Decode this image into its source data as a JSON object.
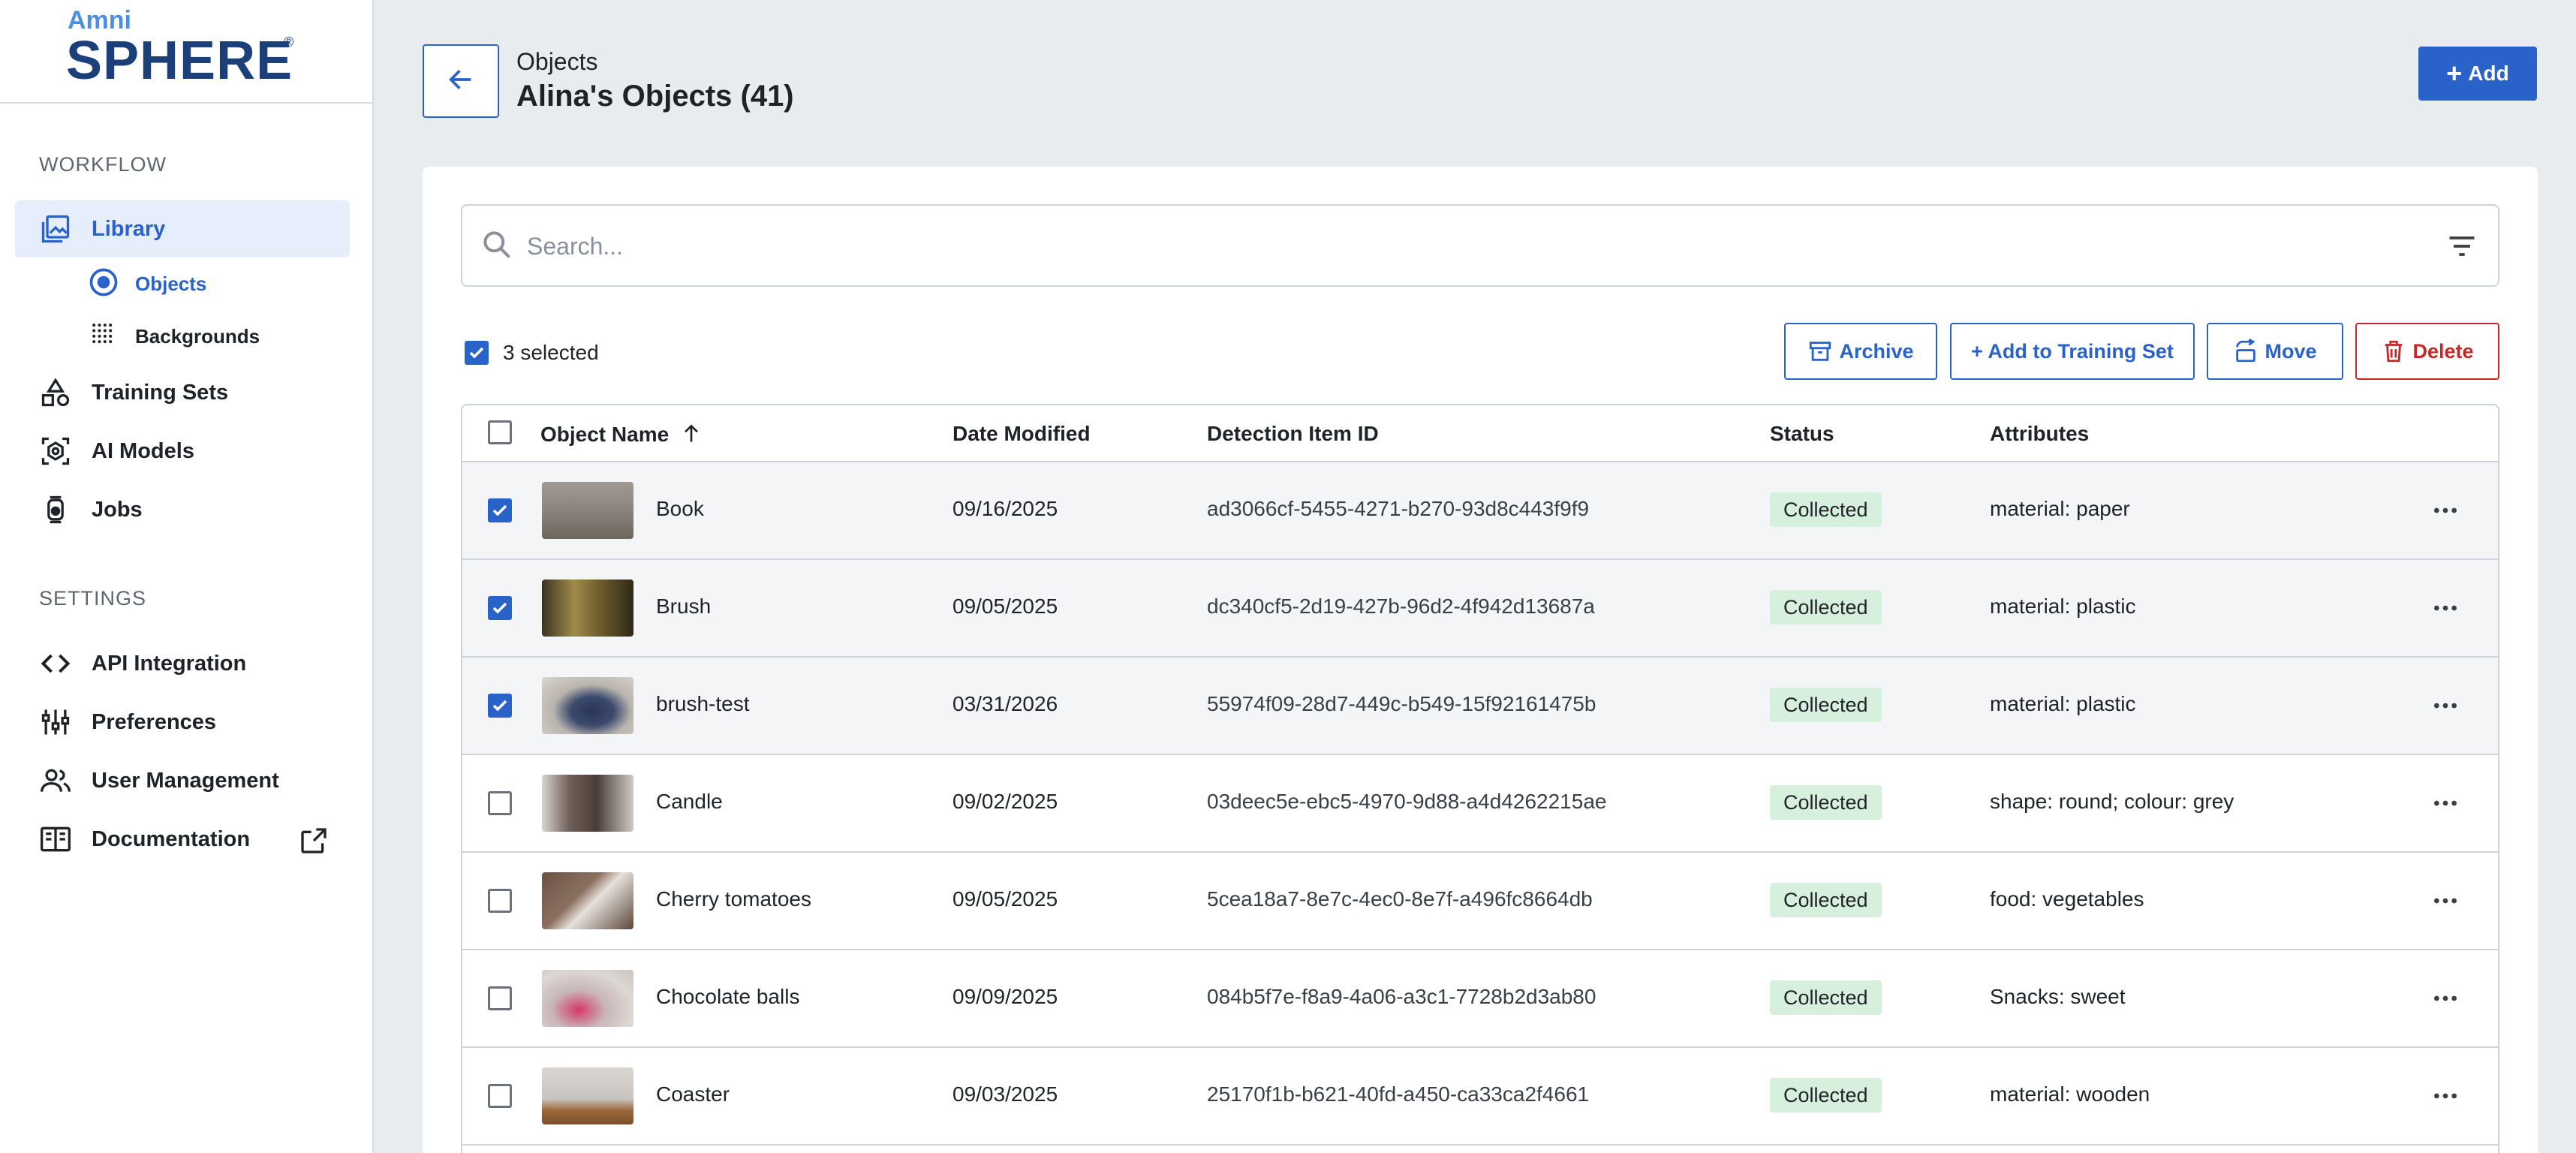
{
  "logo": {
    "small": "Amni",
    "big": "SPHERE",
    "reg": "®"
  },
  "sidebar": {
    "workflow_label": "WORKFLOW",
    "settings_label": "SETTINGS",
    "library": "Library",
    "objects": "Objects",
    "backgrounds": "Backgrounds",
    "training_sets": "Training Sets",
    "ai_models": "AI Models",
    "jobs": "Jobs",
    "api_integration": "API Integration",
    "preferences": "Preferences",
    "user_management": "User Management",
    "documentation": "Documentation"
  },
  "header": {
    "breadcrumb": "Objects",
    "title": "Alina's Objects (41)",
    "add_label": "Add",
    "add_plus": "+"
  },
  "search": {
    "placeholder": "Search..."
  },
  "selection": {
    "text": "3 selected"
  },
  "actions": {
    "archive": "Archive",
    "add_training": "+ Add to Training Set",
    "move": "Move",
    "delete": "Delete"
  },
  "table": {
    "headers": {
      "name": "Object Name",
      "date": "Date Modified",
      "detection_id": "Detection Item ID",
      "status": "Status",
      "attributes": "Attributes"
    },
    "rows": [
      {
        "name": "Book",
        "date": "09/16/2025",
        "id": "ad3066cf-5455-4271-b270-93d8c443f9f9",
        "status": "Collected",
        "attributes": "material: paper",
        "selected": true
      },
      {
        "name": "Brush",
        "date": "09/05/2025",
        "id": "dc340cf5-2d19-427b-96d2-4f942d13687a",
        "status": "Collected",
        "attributes": "material: plastic",
        "selected": true
      },
      {
        "name": "brush-test",
        "date": "03/31/2026",
        "id": "55974f09-28d7-449c-b549-15f92161475b",
        "status": "Collected",
        "attributes": "material: plastic",
        "selected": true
      },
      {
        "name": "Candle",
        "date": "09/02/2025",
        "id": "03deec5e-ebc5-4970-9d88-a4d4262215ae",
        "status": "Collected",
        "attributes": "shape: round; colour: grey",
        "selected": false
      },
      {
        "name": "Cherry tomatoes",
        "date": "09/05/2025",
        "id": "5cea18a7-8e7c-4ec0-8e7f-a496fc8664db",
        "status": "Collected",
        "attributes": "food: vegetables",
        "selected": false
      },
      {
        "name": "Chocolate balls",
        "date": "09/09/2025",
        "id": "084b5f7e-f8a9-4a06-a3c1-7728b2d3ab80",
        "status": "Collected",
        "attributes": "Snacks: sweet",
        "selected": false
      },
      {
        "name": "Coaster",
        "date": "09/03/2025",
        "id": "25170f1b-b621-40fd-a450-ca33ca2f4661",
        "status": "Collected",
        "attributes": "material: wooden",
        "selected": false
      }
    ]
  },
  "colors": {
    "accent": "#2962c9",
    "danger": "#c62828",
    "status_bg": "#d7f0dd"
  }
}
